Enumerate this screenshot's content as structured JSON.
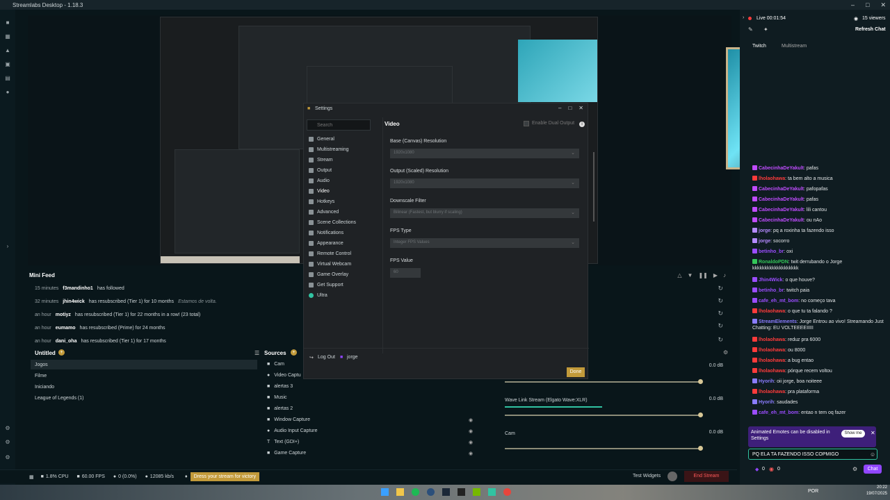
{
  "window": {
    "title": "Streamlabs Desktop - 1.18.3"
  },
  "settings": {
    "title": "Settings",
    "search_placeholder": "Search",
    "section": "Video",
    "dual_output": "Enable Dual Output",
    "nav": [
      "General",
      "Multistreaming",
      "Stream",
      "Output",
      "Audio",
      "Video",
      "Hotkeys",
      "Advanced",
      "Scene Collections",
      "Notifications",
      "Appearance",
      "Remote Control",
      "Virtual Webcam",
      "Game Overlay",
      "Get Support",
      "Ultra"
    ],
    "fields": [
      {
        "label": "Base (Canvas) Resolution",
        "value": "1920x1080"
      },
      {
        "label": "Output (Scaled) Resolution",
        "value": "1920x1080"
      },
      {
        "label": "Downscale Filter",
        "value": "Bilinear (Fastest, but blurry if scaling)"
      },
      {
        "label": "FPS Type",
        "value": "Integer FPS Values"
      }
    ],
    "fps_label": "FPS Value",
    "fps_value": "60",
    "logout": "Log Out",
    "user": "jorge",
    "done": "Done"
  },
  "minifeed": {
    "title": "Mini Feed",
    "rows": [
      {
        "time": "15 minutes",
        "user": "f3mandinho1",
        "text": "has followed",
        "msg": ""
      },
      {
        "time": "32 minutes",
        "user": "jhin4wick",
        "text": "has resubscribed (Tier 1) for 10 months",
        "msg": "Estamos de volta."
      },
      {
        "time": "an hour",
        "user": "motiyz",
        "text": "has resubscribed (Tier 1) for 22 months in a row! (23 total)",
        "msg": ""
      },
      {
        "time": "an hour",
        "user": "eumamo",
        "text": "has resubscribed (Prime) for 24 months",
        "msg": ""
      },
      {
        "time": "an hour",
        "user": "dani_oha",
        "text": "has resubscribed (Tier 1) for 17 months",
        "msg": ""
      }
    ]
  },
  "scenes": {
    "title": "Untitled",
    "items": [
      "Jogos",
      "Filme",
      "Iniciando",
      "League of Legends (1)"
    ]
  },
  "sources": {
    "title": "Sources",
    "items": [
      "Cam",
      "Video Captu",
      "alertas 3",
      "Music",
      "alertas 2",
      "Window Capture",
      "Audio Input Capture",
      "Text (GDI+)",
      "Game Capture"
    ]
  },
  "mixer": [
    {
      "name": "",
      "db": "0.0 dB"
    },
    {
      "name": "Wave Link Stream (Elgato Wave:XLR)",
      "db": "0.0 dB"
    },
    {
      "name": "Cam",
      "db": "0.0 dB"
    }
  ],
  "footer": {
    "cpu": "1.8% CPU",
    "fps": "60.00 FPS",
    "dropped": "0 (0.0%)",
    "kbps": "12085 kb/s",
    "promo": "Dress your stream for victory",
    "test_widgets": "Test Widgets",
    "end_stream": "End Stream"
  },
  "stream": {
    "live": "Live 00:01:54",
    "viewers": "15 viewers",
    "refresh": "Refresh Chat",
    "tab1": "Twitch",
    "tab2": "Multistream"
  },
  "chat": [
    {
      "user": "CabecinhaDeYakult",
      "text": "pafas",
      "color": "#c04cff"
    },
    {
      "user": "lholaohawa",
      "text": "ta bem alto a musica",
      "color": "#ff3b3b"
    },
    {
      "user": "CabecinhaDeYakult",
      "text": "pafopafas",
      "color": "#c04cff"
    },
    {
      "user": "CabecinhaDeYakult",
      "text": "pafas",
      "color": "#c04cff"
    },
    {
      "user": "CabecinhaDeYakult",
      "text": "lili cantou",
      "color": "#c04cff"
    },
    {
      "user": "CabecinhaDeYakult",
      "text": "ou nAo",
      "color": "#c04cff"
    },
    {
      "user": "jorge",
      "text": "pq a roxinha ta fazendo isso",
      "color": "#b58aff"
    },
    {
      "user": "jorge",
      "text": "socorro",
      "color": "#b58aff"
    },
    {
      "user": "betinho_br",
      "text": "oxi",
      "color": "#9b4dff"
    },
    {
      "user": "RonaldoPDN",
      "text": "twit derrubando o Jorge kkkkkkkkkkkkkkkkkkk",
      "color": "#34c759"
    },
    {
      "user": "Jhin4Wick",
      "text": "o que houve?",
      "color": "#9b4dff"
    },
    {
      "user": "betinho_br",
      "text": "twitch paia",
      "color": "#9b4dff"
    },
    {
      "user": "cafe_eh_mt_bom",
      "text": "no começo tava",
      "color": "#9b4dff"
    },
    {
      "user": "lholaohawa",
      "text": "o que tu ta falando ?",
      "color": "#ff3b3b"
    },
    {
      "user": "StreamElements",
      "text": "Jorge Entrou ao vivo! Streamando Just Chatting: EU VOLTEEEEIIIII",
      "color": "#8a7cff"
    },
    {
      "user": "lholaohawa",
      "text": "reduz pra 6000",
      "color": "#ff3b3b"
    },
    {
      "user": "lholaohawa",
      "text": "ou 8000",
      "color": "#ff3b3b"
    },
    {
      "user": "lholaohawa",
      "text": "a bug entao",
      "color": "#ff3b3b"
    },
    {
      "user": "lholaohawa",
      "text": "pórque recem voltou",
      "color": "#ff3b3b"
    },
    {
      "user": "Hyorih",
      "text": "oii jorge, boa noiteee",
      "color": "#8a7cff"
    },
    {
      "user": "lholaohawa",
      "text": "pra plataforma",
      "color": "#ff3b3b"
    },
    {
      "user": "Hyorih",
      "text": "saudades",
      "color": "#8a7cff"
    },
    {
      "user": "cafe_eh_mt_bom",
      "text": "entao n tem oq fazer",
      "color": "#9b4dff"
    }
  ],
  "chat_notice": {
    "text": "Animated Emotes can be disabled in Settings",
    "button": "Show me"
  },
  "chat_input": {
    "value": "PQ ELA TA FAZENDO ISSO COPMIGO",
    "send": "Chat",
    "points": "0",
    "bits": "0"
  },
  "taskbar": {
    "lang": "POR",
    "time": "20:22",
    "date": "19/07/2025"
  },
  "colors": {
    "accent": "#31c3a2",
    "live": "#ff3b3b",
    "done": "#c29a3a",
    "chat_btn": "#9146ff"
  }
}
